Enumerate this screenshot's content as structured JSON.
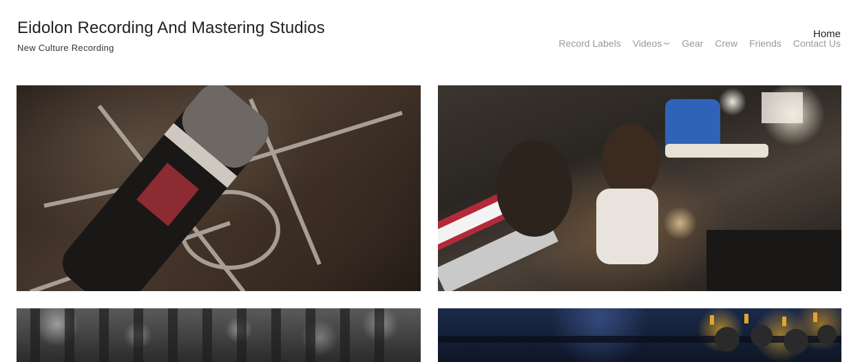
{
  "site": {
    "title": "Eidolon Recording And Mastering Studios",
    "tagline": "New Culture Recording"
  },
  "nav": {
    "home": "Home",
    "items": [
      {
        "label": "Record Labels"
      },
      {
        "label": "Videos",
        "icon": "chevron-down-icon"
      },
      {
        "label": "Gear"
      },
      {
        "label": "Crew"
      },
      {
        "label": "Friends"
      },
      {
        "label": "Contact Us"
      }
    ],
    "active_color": "#222222",
    "inactive_color": "#999999"
  },
  "gallery": {
    "tiles": [
      {
        "subject": "microphone-photo"
      },
      {
        "subject": "band-recording-photo"
      },
      {
        "subject": "mixing-console-photo"
      },
      {
        "subject": "outboard-rack-photo"
      }
    ]
  }
}
